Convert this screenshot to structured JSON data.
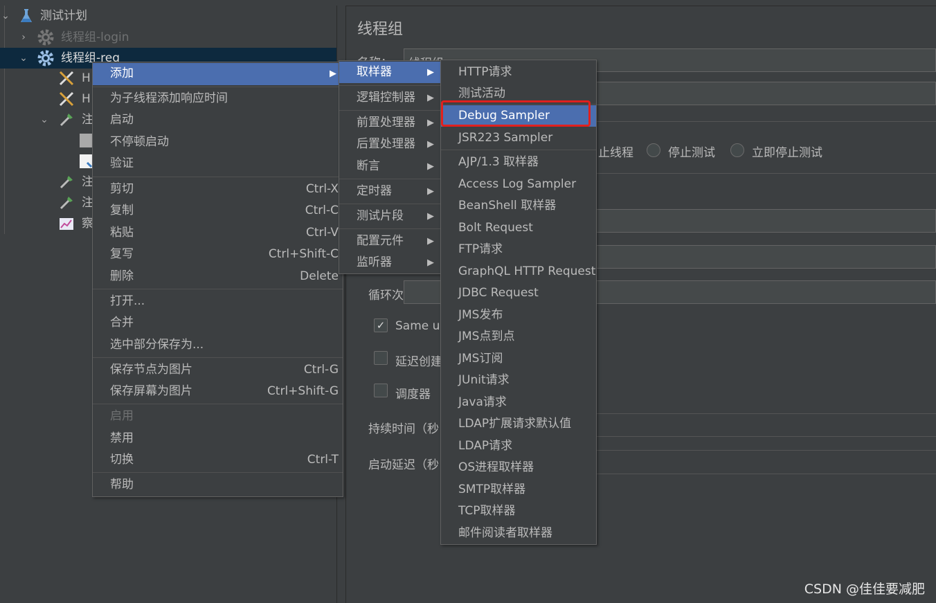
{
  "tree": {
    "items": [
      {
        "label": "测试计划",
        "icon": "flask-icon",
        "arrow": "⌄"
      },
      {
        "label": "线程组-login",
        "icon": "gear-icon",
        "arrow": "›"
      },
      {
        "label": "线程组-reg",
        "icon": "gear-icon",
        "arrow": "⌄"
      },
      {
        "label": "H",
        "icon": "tools-icon"
      },
      {
        "label": "H",
        "icon": "tools-icon"
      },
      {
        "label": "注",
        "icon": "dropper-icon",
        "arrow": "⌄"
      },
      {
        "label": "",
        "icon": "document-icon"
      },
      {
        "label": "",
        "icon": "script-icon"
      },
      {
        "label": "注",
        "icon": "dropper-icon"
      },
      {
        "label": "注",
        "icon": "dropper-icon"
      },
      {
        "label": "察",
        "icon": "graph-icon"
      }
    ]
  },
  "panel": {
    "title": "线程组",
    "name_label": "名称：",
    "name_value": "线程组",
    "radio_options": [
      "止线程",
      "停止测试",
      "立即停止测试"
    ],
    "loop_label": "循环次数",
    "same_user_label": "Same us",
    "delay_label": "延迟创建",
    "scheduler_label": "调度器",
    "duration_label": "持续时间（秒",
    "startup_delay_label": "启动延迟（秒"
  },
  "context_menu": {
    "items": [
      {
        "label": "添加",
        "submenu": true
      },
      {
        "label": "为子线程添加响应时间"
      },
      {
        "label": "启动"
      },
      {
        "label": "不停顿启动"
      },
      {
        "label": "验证"
      },
      {
        "label": "剪切",
        "shortcut": "Ctrl-X"
      },
      {
        "label": "复制",
        "shortcut": "Ctrl-C"
      },
      {
        "label": "粘贴",
        "shortcut": "Ctrl-V"
      },
      {
        "label": "复写",
        "shortcut": "Ctrl+Shift-C"
      },
      {
        "label": "删除",
        "shortcut": "Delete"
      },
      {
        "label": "打开..."
      },
      {
        "label": "合并"
      },
      {
        "label": "选中部分保存为..."
      },
      {
        "label": "保存节点为图片",
        "shortcut": "Ctrl-G"
      },
      {
        "label": "保存屏幕为图片",
        "shortcut": "Ctrl+Shift-G"
      },
      {
        "label": "启用"
      },
      {
        "label": "禁用"
      },
      {
        "label": "切换",
        "shortcut": "Ctrl-T"
      },
      {
        "label": "帮助"
      }
    ]
  },
  "add_submenu": {
    "items": [
      "取样器",
      "逻辑控制器",
      "前置处理器",
      "后置处理器",
      "断言",
      "定时器",
      "测试片段",
      "配置元件",
      "监听器"
    ]
  },
  "sampler_submenu": {
    "items": [
      "HTTP请求",
      "测试活动",
      "Debug Sampler",
      "JSR223 Sampler",
      "AJP/1.3 取样器",
      "Access Log Sampler",
      "BeanShell 取样器",
      "Bolt Request",
      "FTP请求",
      "GraphQL HTTP Request",
      "JDBC Request",
      "JMS发布",
      "JMS点到点",
      "JMS订阅",
      "JUnit请求",
      "Java请求",
      "LDAP扩展请求默认值",
      "LDAP请求",
      "OS进程取样器",
      "SMTP取样器",
      "TCP取样器",
      "邮件阅读者取样器"
    ]
  },
  "watermark": "CSDN @佳佳要减肥",
  "colors": {
    "highlight": "#4b6eaf",
    "annotation_box": "#e0201e",
    "background": "#3c3f41"
  }
}
